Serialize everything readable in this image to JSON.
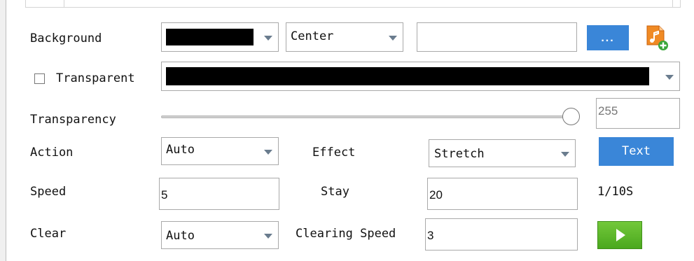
{
  "background": {
    "label": "Background",
    "color_value": "#000000",
    "position_value": "Center",
    "path_value": "",
    "browse_label": "...",
    "music_icon": "music-file-add-icon"
  },
  "transparent": {
    "label": "Transparent",
    "checked": false,
    "color_value": "#000000"
  },
  "transparency": {
    "label": "Transparency",
    "slider_value_fraction": 1.0,
    "value": "255"
  },
  "action": {
    "label": "Action",
    "value": "Auto"
  },
  "effect": {
    "label": "Effect",
    "value": "Stretch"
  },
  "text_button": {
    "label": "Text"
  },
  "speed": {
    "label": "Speed",
    "value": "5"
  },
  "stay": {
    "label": "Stay",
    "value": "20",
    "unit": "1/10S"
  },
  "clear": {
    "label": "Clear",
    "value": "Auto"
  },
  "clearing_speed": {
    "label": "Clearing Speed",
    "value": "3"
  },
  "play_button": {
    "icon": "play-icon"
  },
  "colors": {
    "accent_blue": "#3a86d8",
    "play_green": "#5cb82a",
    "dropdown_arrow": "#6a7c8e"
  }
}
